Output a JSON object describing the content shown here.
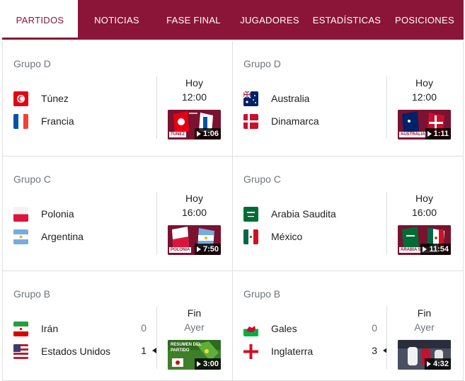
{
  "tabs": [
    {
      "label": "PARTIDOS",
      "active": true
    },
    {
      "label": "NOTICIAS",
      "active": false
    },
    {
      "label": "FASE FINAL",
      "active": false
    },
    {
      "label": "JUGADORES",
      "active": false
    },
    {
      "label": "ESTADÍSTICAS",
      "active": false
    },
    {
      "label": "POSICIONES",
      "active": false
    }
  ],
  "matches": [
    {
      "group": "Grupo D",
      "team1": {
        "name": "Túnez",
        "flag": "tunisia-flag-icon"
      },
      "team2": {
        "name": "Francia",
        "flag": "france-flag-icon"
      },
      "status_line1": "Hoy",
      "status_line2": "12:00",
      "video_duration": "1:06",
      "thumb_caption": "TÚNEZ"
    },
    {
      "group": "Grupo D",
      "team1": {
        "name": "Australia",
        "flag": "australia-flag-icon"
      },
      "team2": {
        "name": "Dinamarca",
        "flag": "denmark-flag-icon"
      },
      "status_line1": "Hoy",
      "status_line2": "12:00",
      "video_duration": "1:11",
      "thumb_caption": "AUSTRALIA"
    },
    {
      "group": "Grupo C",
      "team1": {
        "name": "Polonia",
        "flag": "poland-flag-icon"
      },
      "team2": {
        "name": "Argentina",
        "flag": "argentina-flag-icon"
      },
      "status_line1": "Hoy",
      "status_line2": "16:00",
      "video_duration": "7:50",
      "thumb_caption": "POLONIA"
    },
    {
      "group": "Grupo C",
      "team1": {
        "name": "Arabia Saudita",
        "flag": "saudi-arabia-flag-icon"
      },
      "team2": {
        "name": "México",
        "flag": "mexico-flag-icon"
      },
      "status_line1": "Hoy",
      "status_line2": "16:00",
      "video_duration": "11:54",
      "thumb_caption": "ARABIA SAUDITA"
    },
    {
      "group": "Grupo B",
      "team1": {
        "name": "Irán",
        "flag": "iran-flag-icon",
        "score": "0"
      },
      "team2": {
        "name": "Estados Unidos",
        "flag": "usa-flag-icon",
        "score": "1",
        "winner": true
      },
      "status_line1": "Fin",
      "status_line2": "Ayer",
      "video_duration": "3:00",
      "thumb_caption": "RESUMEN DEL PARTIDO"
    },
    {
      "group": "Grupo B",
      "team1": {
        "name": "Gales",
        "flag": "wales-flag-icon",
        "score": "0"
      },
      "team2": {
        "name": "Inglaterra",
        "flag": "england-flag-icon",
        "score": "3",
        "winner": true
      },
      "status_line1": "Fin",
      "status_line2": "Ayer",
      "video_duration": "4:32",
      "thumb_caption": ""
    }
  ],
  "colors": {
    "brand": "#8a1538",
    "muted": "#70757a",
    "divider": "#e0e0e0"
  }
}
